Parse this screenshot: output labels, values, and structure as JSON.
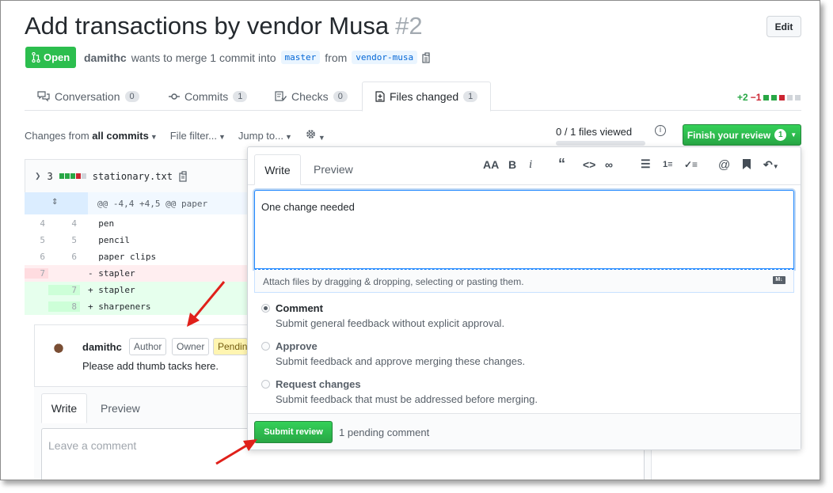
{
  "header": {
    "title": "Add transactions by vendor Musa",
    "number": "#2",
    "edit_label": "Edit",
    "state_label": "Open",
    "author": "damithc",
    "merge_text": "wants to merge 1 commit into",
    "base_branch": "master",
    "from_text": "from",
    "head_branch": "vendor-musa"
  },
  "tabs": [
    {
      "label": "Conversation",
      "count": "0"
    },
    {
      "label": "Commits",
      "count": "1"
    },
    {
      "label": "Checks",
      "count": "0"
    },
    {
      "label": "Files changed",
      "count": "1"
    }
  ],
  "diffstat": {
    "additions": "+2",
    "deletions": "−1"
  },
  "toolbar": {
    "changes_prefix": "Changes from",
    "changes_value": "all commits",
    "file_filter": "File filter...",
    "jump_to": "Jump to...",
    "files_viewed": "0 / 1 files viewed",
    "finish_review": "Finish your review",
    "finish_count": "1"
  },
  "file": {
    "changes": "3",
    "name": "stationary.txt",
    "hunk": "@@ -4,4 +4,5 @@ paper",
    "lines": [
      {
        "old": "4",
        "new": "4",
        "code": "  pen",
        "type": "ctx"
      },
      {
        "old": "5",
        "new": "5",
        "code": "  pencil",
        "type": "ctx"
      },
      {
        "old": "6",
        "new": "6",
        "code": "  paper clips",
        "type": "ctx"
      },
      {
        "old": "7",
        "new": "",
        "code": "- stapler",
        "type": "del"
      },
      {
        "old": "",
        "new": "7",
        "code": "+ stapler",
        "type": "add"
      },
      {
        "old": "",
        "new": "8",
        "code": "+ sharpeners",
        "type": "add"
      }
    ]
  },
  "thread": {
    "author": "damithc",
    "labels": [
      "Author",
      "Owner"
    ],
    "pending_label": "Pending",
    "body": "Please add thumb tacks here.",
    "write_tab": "Write",
    "preview_tab": "Preview",
    "placeholder": "Leave a comment"
  },
  "review": {
    "write_tab": "Write",
    "preview_tab": "Preview",
    "text": "One change needed",
    "attach_hint": "Attach files by dragging & dropping, selecting or pasting them.",
    "options": [
      {
        "title": "Comment",
        "desc": "Submit general feedback without explicit approval.",
        "checked": true
      },
      {
        "title": "Approve",
        "desc": "Submit feedback and approve merging these changes.",
        "checked": false
      },
      {
        "title": "Request changes",
        "desc": "Submit feedback that must be addressed before merging.",
        "checked": false
      }
    ],
    "submit_label": "Submit review",
    "pending_text": "1 pending comment"
  },
  "colors": {
    "green": "#28a745",
    "red": "#cb2431",
    "annotation_arrow": "#e0201a"
  }
}
